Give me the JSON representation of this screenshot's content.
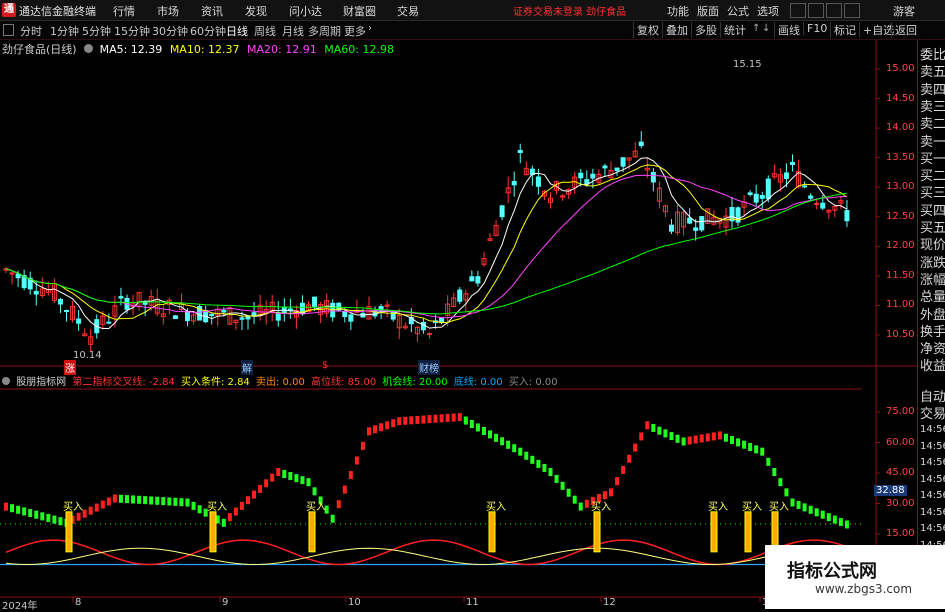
{
  "app": {
    "title": "通达信金融终端",
    "logo": "通"
  },
  "menu": {
    "items": [
      "行情",
      "市场",
      "资讯",
      "发现",
      "问小达",
      "财富圈",
      "交易"
    ],
    "warning": "证券交易未登录 劲仔食品",
    "right": [
      "功能",
      "版面",
      "公式",
      "选项",
      "游客"
    ]
  },
  "periods": {
    "items": [
      "分时",
      "1分钟",
      "5分钟",
      "15分钟",
      "30分钟",
      "60分钟",
      "日线",
      "周线",
      "月线",
      "多周期",
      "更多"
    ],
    "active": "日线"
  },
  "tools": [
    "复权",
    "叠加",
    "多股",
    "统计",
    "画线",
    "F10",
    "标记",
    "+自选",
    "返回"
  ],
  "chart": {
    "name": "劲仔食品(日线)",
    "ma": [
      {
        "label": "MA5: 12.39",
        "color": "#ffffff"
      },
      {
        "label": "MA10: 12.37",
        "color": "#ffff00"
      },
      {
        "label": "MA20: 12.91",
        "color": "#ff44ff"
      },
      {
        "label": "MA60: 12.98",
        "color": "#00ff00"
      }
    ],
    "high_label": "15.15",
    "low_label": "10.14",
    "price_ticks": [
      "15.00",
      "14.50",
      "14.00",
      "13.50",
      "13.00",
      "12.50",
      "12.00",
      "11.50",
      "11.00",
      "10.50"
    ],
    "markers": [
      "涨",
      "解",
      "$",
      "财榜"
    ]
  },
  "indicator": {
    "name": "股朋指标网",
    "values": [
      {
        "label": "第二指标交叉线: -2.84",
        "color": "#ff3333"
      },
      {
        "label": "买入条件: 2.84",
        "color": "#ffff00"
      },
      {
        "label": "卖出: 0.00",
        "color": "#ff8800"
      },
      {
        "label": "高位线: 85.00",
        "color": "#ff3333"
      },
      {
        "label": "机会线: 20.00",
        "color": "#00ff00"
      },
      {
        "label": "底线: 0.00",
        "color": "#00aaff"
      },
      {
        "label": "买入: 0.00",
        "color": "#888888"
      }
    ],
    "ticks": [
      "75.00",
      "60.00",
      "45.00",
      "30.00",
      "15.00"
    ],
    "current": "32.88",
    "buy_label": "买入",
    "buy_count": 8
  },
  "right_panel": {
    "labels": [
      "委比",
      "卖五",
      "卖四",
      "卖三",
      "卖二",
      "卖一",
      "买一",
      "买二",
      "买三",
      "买四",
      "买五",
      "现价",
      "涨跌",
      "涨幅",
      "总量",
      "外盘",
      "换手",
      "净资",
      "收益",
      "自动",
      "交易"
    ],
    "times": [
      "14:56",
      "14:56",
      "14:56",
      "14:56",
      "14:56",
      "14:56",
      "14:56",
      "14:56"
    ]
  },
  "x_axis": {
    "year": "2024年",
    "months": [
      "8",
      "9",
      "10",
      "11",
      "12",
      "1"
    ]
  },
  "watermark": {
    "title": "指标公式网",
    "url": "www.zbgs3.com"
  },
  "colors": {
    "up": "#ff3232",
    "down": "#54ffff",
    "ma5": "#ffffff",
    "ma10": "#ffff00",
    "ma20": "#ff44ff",
    "ma60": "#00ff00",
    "frame": "#8b1010"
  }
}
